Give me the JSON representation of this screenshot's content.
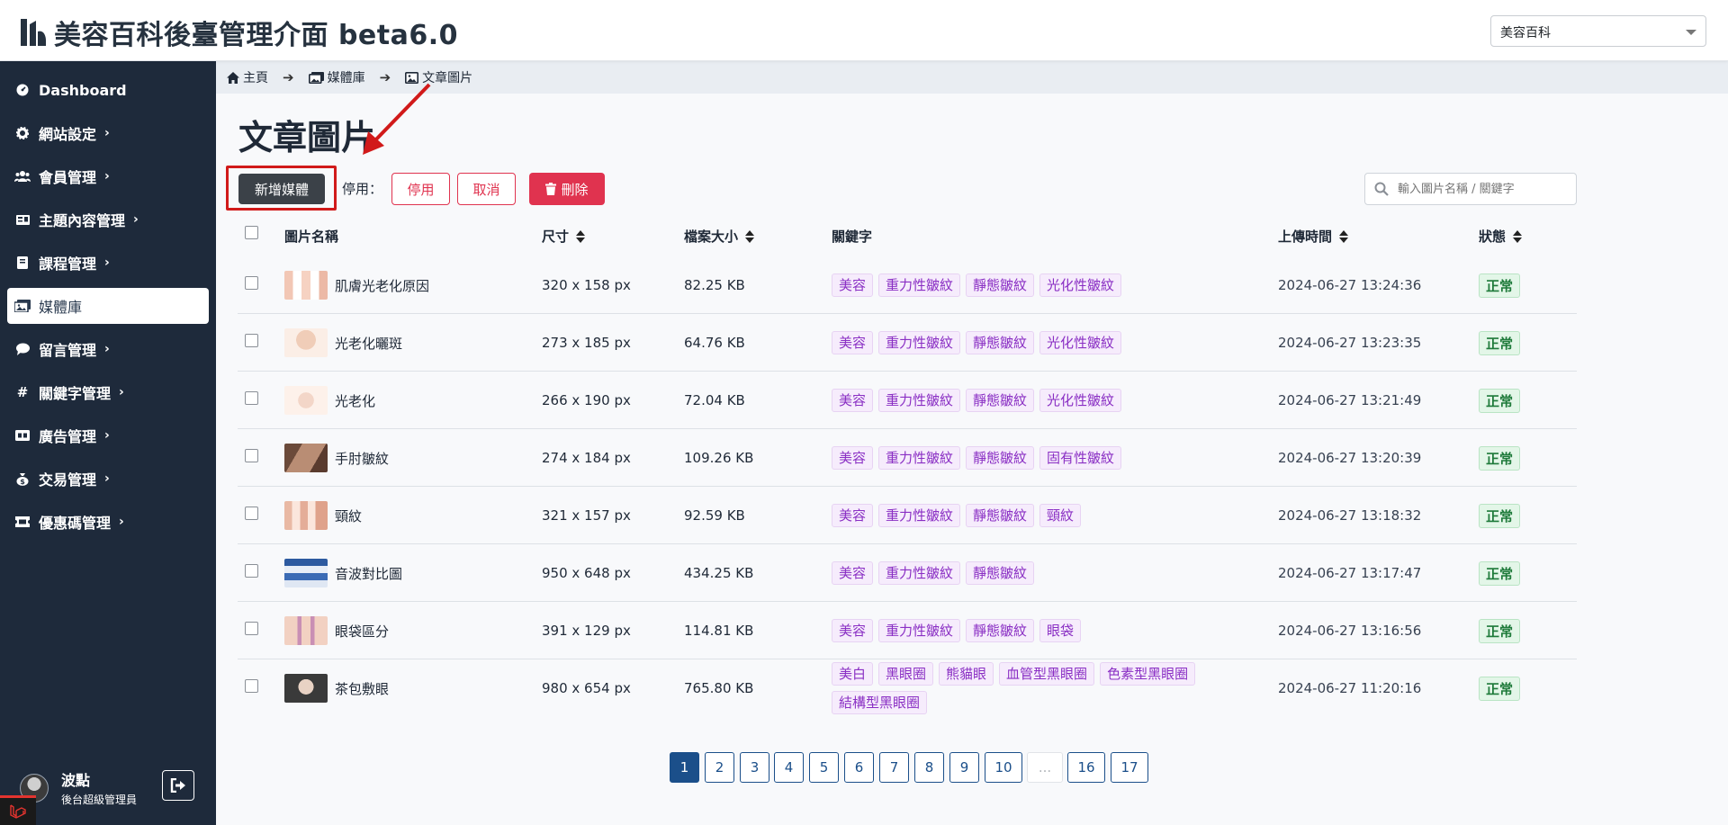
{
  "app": {
    "title": "美容百科後臺管理介面 beta6.0",
    "site_select_value": "美容百科"
  },
  "sidebar": {
    "items": [
      {
        "label": "Dashboard",
        "icon": "dashboard-icon",
        "has_children": false,
        "active": false
      },
      {
        "label": "網站設定",
        "icon": "gear-icon",
        "has_children": true,
        "active": false
      },
      {
        "label": "會員管理",
        "icon": "users-icon",
        "has_children": true,
        "active": false
      },
      {
        "label": "主題內容管理",
        "icon": "book-open-icon",
        "has_children": true,
        "active": false
      },
      {
        "label": "課程管理",
        "icon": "book-icon",
        "has_children": true,
        "active": false
      },
      {
        "label": "媒體庫",
        "icon": "images-icon",
        "has_children": false,
        "active": true
      },
      {
        "label": "留言管理",
        "icon": "comment-icon",
        "has_children": true,
        "active": false
      },
      {
        "label": "關鍵字管理",
        "icon": "hashtag-icon",
        "has_children": true,
        "active": false
      },
      {
        "label": "廣告管理",
        "icon": "ad-icon",
        "has_children": true,
        "active": false
      },
      {
        "label": "交易管理",
        "icon": "money-bag-icon",
        "has_children": true,
        "active": false
      },
      {
        "label": "優惠碼管理",
        "icon": "ticket-icon",
        "has_children": true,
        "active": false
      }
    ],
    "user": {
      "name": "波點",
      "role": "後台超級管理員"
    }
  },
  "breadcrumb": {
    "home": "主頁",
    "media": "媒體庫",
    "current": "文章圖片"
  },
  "page": {
    "title": "文章圖片",
    "add_button": "新增媒體",
    "disable_label": "停用：",
    "stop_button": "停用",
    "cancel_button": "取消",
    "delete_button": "刪除",
    "search_placeholder": "輸入圖片名稱 / 關鍵字"
  },
  "table": {
    "headers": {
      "name": "圖片名稱",
      "size": "尺寸",
      "filesize": "檔案大小",
      "keywords": "關鍵字",
      "uploaded": "上傳時間",
      "status": "狀態"
    },
    "rows": [
      {
        "name": "肌膚光老化原因",
        "size": "320 x 158 px",
        "filesize": "82.25 KB",
        "tags": [
          "美容",
          "重力性皺紋",
          "靜態皺紋",
          "光化性皺紋"
        ],
        "time": "2024-06-27 13:24:36",
        "status": "正常"
      },
      {
        "name": "光老化曬斑",
        "size": "273 x 185 px",
        "filesize": "64.76 KB",
        "tags": [
          "美容",
          "重力性皺紋",
          "靜態皺紋",
          "光化性皺紋"
        ],
        "time": "2024-06-27 13:23:35",
        "status": "正常"
      },
      {
        "name": "光老化",
        "size": "266 x 190 px",
        "filesize": "72.04 KB",
        "tags": [
          "美容",
          "重力性皺紋",
          "靜態皺紋",
          "光化性皺紋"
        ],
        "time": "2024-06-27 13:21:49",
        "status": "正常"
      },
      {
        "name": "手肘皺紋",
        "size": "274 x 184 px",
        "filesize": "109.26 KB",
        "tags": [
          "美容",
          "重力性皺紋",
          "靜態皺紋",
          "固有性皺紋"
        ],
        "time": "2024-06-27 13:20:39",
        "status": "正常"
      },
      {
        "name": "頸紋",
        "size": "321 x 157 px",
        "filesize": "92.59 KB",
        "tags": [
          "美容",
          "重力性皺紋",
          "靜態皺紋",
          "頸紋"
        ],
        "time": "2024-06-27 13:18:32",
        "status": "正常"
      },
      {
        "name": "音波對比圖",
        "size": "950 x 648 px",
        "filesize": "434.25 KB",
        "tags": [
          "美容",
          "重力性皺紋",
          "靜態皺紋"
        ],
        "time": "2024-06-27 13:17:47",
        "status": "正常"
      },
      {
        "name": "眼袋區分",
        "size": "391 x 129 px",
        "filesize": "114.81 KB",
        "tags": [
          "美容",
          "重力性皺紋",
          "靜態皺紋",
          "眼袋"
        ],
        "time": "2024-06-27 13:16:56",
        "status": "正常"
      },
      {
        "name": "茶包敷眼",
        "size": "980 x 654 px",
        "filesize": "765.80 KB",
        "tags": [
          "美白",
          "黑眼圈",
          "熊貓眼",
          "血管型黑眼圈",
          "色素型黑眼圈",
          "結構型黑眼圈"
        ],
        "time": "2024-06-27 11:20:16",
        "status": "正常"
      }
    ]
  },
  "pagination": {
    "pages": [
      "1",
      "2",
      "3",
      "4",
      "5",
      "6",
      "7",
      "8",
      "9",
      "10",
      "...",
      "16",
      "17"
    ],
    "current": "1"
  },
  "colors": {
    "sidebar_bg": "#1e2a3b",
    "danger": "#e0334f",
    "tag_text": "#8a2fc4",
    "status_ok": "#1e7a3a",
    "page_active": "#1b4f8a",
    "annotation": "#d11a1a"
  }
}
